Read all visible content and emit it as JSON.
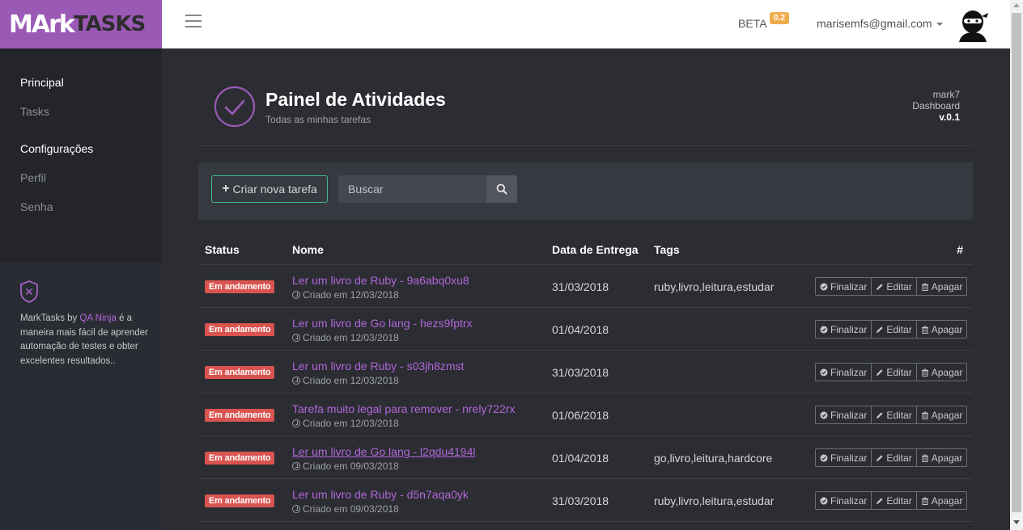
{
  "brand": {
    "mark": "MArk",
    "tasks": "TASKS"
  },
  "header": {
    "beta_label": "BETA",
    "beta_version": "0.2",
    "user_email": "marisemfs@gmail.com"
  },
  "sidebar": {
    "section1": "Principal",
    "item_tasks": "Tasks",
    "section2": "Configurações",
    "item_perfil": "Perfil",
    "item_senha": "Senha",
    "footer_prefix": "MarkTasks by ",
    "footer_link": "QA Ninja",
    "footer_suffix": " é a maneira mais fácil de aprender automação de testes e obter excelentes resultados.."
  },
  "page": {
    "title": "Painel de Atividades",
    "subtitle": "Todas as minhas tarefas",
    "app_name": "mark7",
    "app_section": "Dashboard",
    "app_version": "v.0.1"
  },
  "toolbar": {
    "new_task_label": "Criar nova tarefa",
    "search_placeholder": "Buscar"
  },
  "table": {
    "headers": {
      "status": "Status",
      "name": "Nome",
      "due": "Data de Entrega",
      "tags": "Tags",
      "hash": "#"
    },
    "actions": {
      "finish": "Finalizar",
      "edit": "Editar",
      "delete": "Apagar"
    },
    "rows": [
      {
        "status": "Em andamento",
        "name": "Ler um livro de Ruby - 9a6abq0xu8",
        "created": "Criado em 12/03/2018",
        "due": "31/03/2018",
        "tags": "ruby,livro,leitura,estudar"
      },
      {
        "status": "Em andamento",
        "name": "Ler um livro de Go lang - hezs9fptrx",
        "created": "Criado em 12/03/2018",
        "due": "01/04/2018",
        "tags": ""
      },
      {
        "status": "Em andamento",
        "name": "Ler um livro de Ruby - s03jh8zmst",
        "created": "Criado em 12/03/2018",
        "due": "31/03/2018",
        "tags": ""
      },
      {
        "status": "Em andamento",
        "name": "Tarefa muito legal para remover - nrely722rx",
        "created": "Criado em 12/03/2018",
        "due": "01/06/2018",
        "tags": ""
      },
      {
        "status": "Em andamento",
        "name": "Ler um livro de Go lang - l2qdu4194l",
        "created": "Criado em 09/03/2018",
        "due": "01/04/2018",
        "tags": "go,livro,leitura,hardcore"
      },
      {
        "status": "Em andamento",
        "name": "Ler um livro de Ruby - d5n7aqa0yk",
        "created": "Criado em 09/03/2018",
        "due": "31/03/2018",
        "tags": "ruby,livro,leitura,estudar"
      }
    ]
  },
  "colors": {
    "brand_purple": "#9b59b6",
    "link_purple": "#b266d9",
    "status_red": "#d9534f",
    "accent_green": "#3dbb8f",
    "beta_orange": "#f0ad4e"
  }
}
